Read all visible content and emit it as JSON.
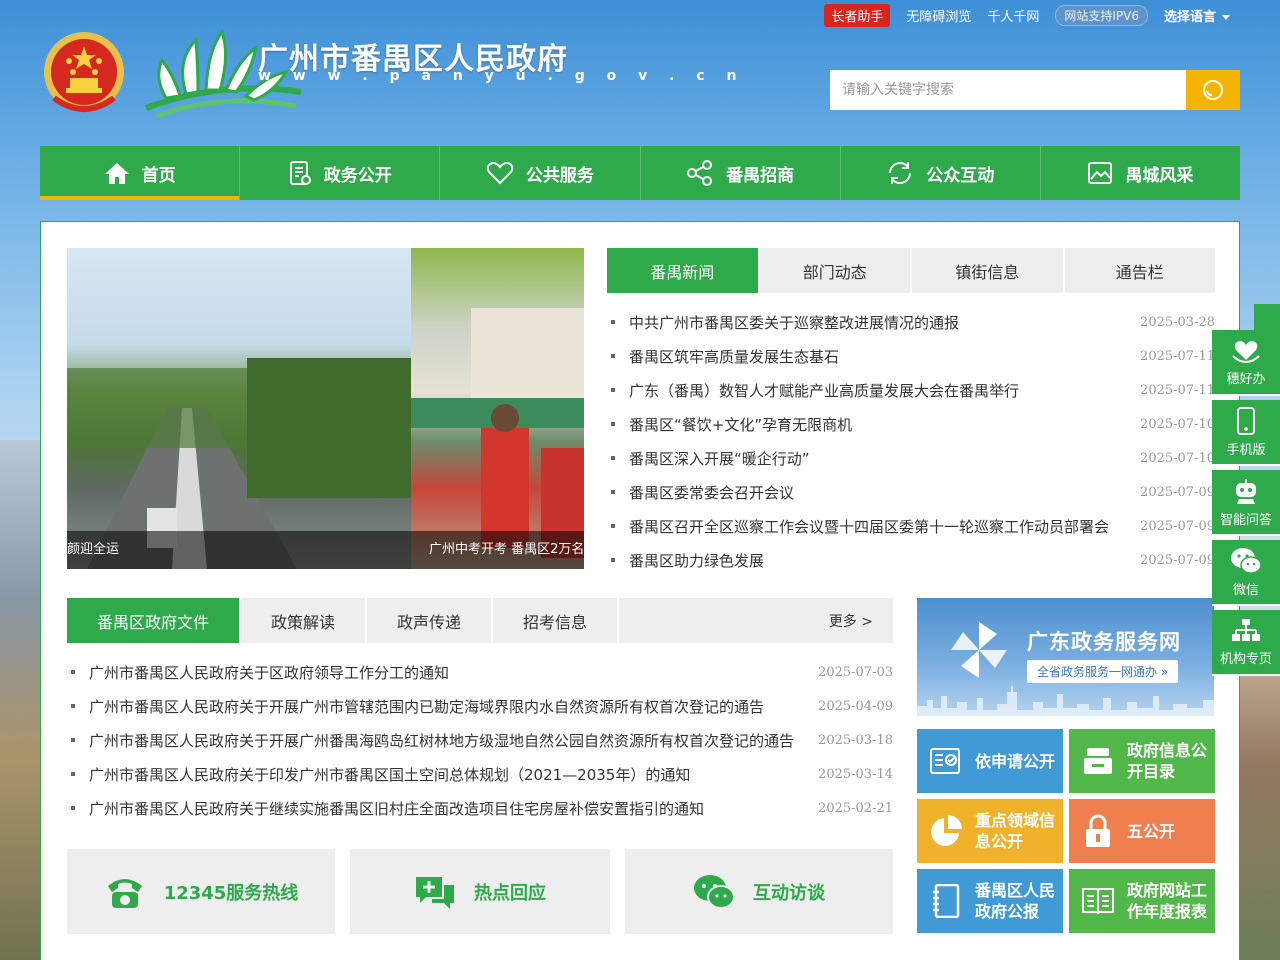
{
  "topbar": {
    "elder_label": "长者助手",
    "accessibility_label": "无障碍浏览",
    "qianren_label": "千人千网",
    "ipv6_label": "网站支持IPV6",
    "language_label": "选择语言"
  },
  "header": {
    "site_title": "广州市番禺区人民政府",
    "site_url": "w w w . p a n y u . g o v . c n",
    "search_placeholder": "请输入关键字搜索"
  },
  "nav": [
    {
      "label": "首页",
      "icon": "home-icon"
    },
    {
      "label": "政务公开",
      "icon": "document-icon"
    },
    {
      "label": "公共服务",
      "icon": "heart-icon"
    },
    {
      "label": "番禺招商",
      "icon": "share-nodes-icon"
    },
    {
      "label": "公众互动",
      "icon": "refresh-icon"
    },
    {
      "label": "禺城风采",
      "icon": "image-icon"
    }
  ],
  "carousel": {
    "captions": [
      "颜迎全运",
      "广州中考开考 番禺区2万名"
    ]
  },
  "news": {
    "tabs": [
      "番禺新闻",
      "部门动态",
      "镇街信息",
      "通告栏"
    ],
    "items": [
      {
        "title": "中共广州市番禺区委关于巡察整改进展情况的通报",
        "date": "2025-03-28"
      },
      {
        "title": "番禺区筑牢高质量发展生态基石",
        "date": "2025-07-11"
      },
      {
        "title": "广东（番禺）数智人才赋能产业高质量发展大会在番禺举行",
        "date": "2025-07-11"
      },
      {
        "title": "番禺区“餐饮+文化”孕育无限商机",
        "date": "2025-07-10"
      },
      {
        "title": "番禺区深入开展“暖企行动”",
        "date": "2025-07-10"
      },
      {
        "title": "番禺区委常委会召开会议",
        "date": "2025-07-09"
      },
      {
        "title": "番禺区召开全区巡察工作会议暨十四届区委第十一轮巡察工作动员部署会",
        "date": "2025-07-09"
      },
      {
        "title": "番禺区助力绿色发展",
        "date": "2025-07-09"
      }
    ]
  },
  "docs": {
    "tabs": [
      "番禺区政府文件",
      "政策解读",
      "政声传递",
      "招考信息"
    ],
    "more_label": "更多 >",
    "items": [
      {
        "title": "广州市番禺区人民政府关于区政府领导工作分工的通知",
        "date": "2025-07-03"
      },
      {
        "title": "广州市番禺区人民政府关于开展广州市管辖范围内已勘定海域界限内水自然资源所有权首次登记的通告",
        "date": "2025-04-09"
      },
      {
        "title": "广州市番禺区人民政府关于开展广州番禺海鸥岛红树林地方级湿地自然公园自然资源所有权首次登记的通告",
        "date": "2025-03-18"
      },
      {
        "title": "广州市番禺区人民政府关于印发广州市番禺区国土空间总体规划（2021—2035年）的通知",
        "date": "2025-03-14"
      },
      {
        "title": "广州市番禺区人民政府关于继续实施番禺区旧村庄全面改造项目住宅房屋补偿安置指引的通知",
        "date": "2025-02-21"
      }
    ]
  },
  "services": [
    {
      "label": "12345服务热线",
      "icon": "telephone-icon"
    },
    {
      "label": "热点回应",
      "icon": "chat-plus-icon"
    },
    {
      "label": "互动访谈",
      "icon": "wechat-bubble-icon"
    }
  ],
  "promo": {
    "title": "广东政务服务网",
    "subtitle": "全省政务服务一网通办 »"
  },
  "tiles": [
    {
      "label": "依申请公开",
      "color": "#3f9ad6",
      "icon": "form-check-icon"
    },
    {
      "label": "政府信息公开目录",
      "color": "#52b84a",
      "icon": "archive-icon"
    },
    {
      "label": "重点领域信息公开",
      "color": "#f0b22a",
      "icon": "pie-chart-icon"
    },
    {
      "label": "五公开",
      "color": "#ef7f4f",
      "icon": "lock-icon"
    },
    {
      "label": "番禺区人民政府公报",
      "color": "#3f9ad6",
      "icon": "notebook-icon"
    },
    {
      "label": "政府网站工作年度报表",
      "color": "#52b84a",
      "icon": "book-list-icon"
    }
  ],
  "side": [
    {
      "label": "穗好办",
      "icon": "heart-hands-icon"
    },
    {
      "label": "手机版",
      "icon": "mobile-icon"
    },
    {
      "label": "智能问答",
      "icon": "robot-icon"
    },
    {
      "label": "微信",
      "icon": "wechat-icon"
    },
    {
      "label": "机构专页",
      "icon": "org-chart-icon"
    }
  ],
  "colors": {
    "brand_green": "#2eaa4b",
    "accent_yellow": "#f5b400",
    "elder_red": "#d9261c"
  }
}
